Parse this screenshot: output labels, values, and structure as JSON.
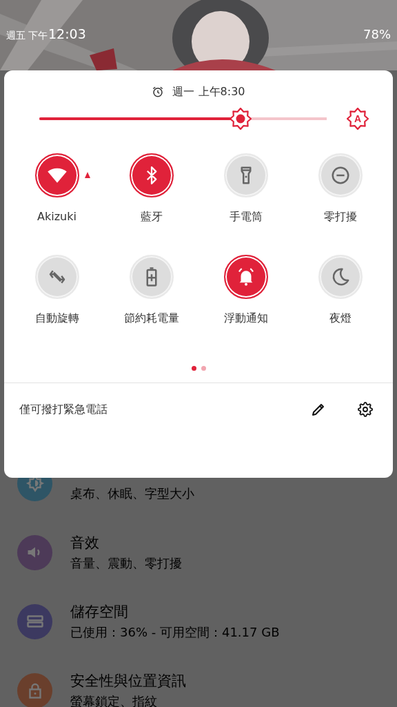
{
  "status_bar": {
    "day": "週五",
    "period": "下午",
    "time": "12:03",
    "battery": "78%"
  },
  "quick_settings": {
    "alarm": "週一 上午8:30",
    "brightness": {
      "level": 0.7,
      "auto_label": "A"
    },
    "tiles": [
      {
        "kind": "wifi",
        "label": "Akizuki",
        "on": true,
        "has_menu": true
      },
      {
        "kind": "bluetooth",
        "label": "藍牙",
        "on": true,
        "has_menu": false
      },
      {
        "kind": "flashlight",
        "label": "手電筒",
        "on": false,
        "has_menu": false
      },
      {
        "kind": "dnd",
        "label": "零打擾",
        "on": false,
        "has_menu": false
      },
      {
        "kind": "rotate",
        "label": "自動旋轉",
        "on": false,
        "has_menu": false
      },
      {
        "kind": "battery",
        "label": "節約耗電量",
        "on": false,
        "has_menu": false
      },
      {
        "kind": "bell",
        "label": "浮動通知",
        "on": true,
        "has_menu": false
      },
      {
        "kind": "moon",
        "label": "夜燈",
        "on": false,
        "has_menu": false
      }
    ],
    "pages": [
      {
        "selected": true
      },
      {
        "selected": false
      }
    ],
    "footer": {
      "text": "僅可撥打緊急電話"
    }
  },
  "settings_list": [
    {
      "kind": "display",
      "color": "#2e5566",
      "subtitle": "桌布、休眠、字型大小"
    },
    {
      "kind": "sound",
      "color": "#4d3a58",
      "title": "音效",
      "subtitle": "音量、震動、零打擾"
    },
    {
      "kind": "storage",
      "color": "#3c3960",
      "title": "儲存空間",
      "subtitle": "已使用：36% - 可用空間：41.17 GB"
    },
    {
      "kind": "security",
      "color": "#6a3f2c",
      "title": "安全性與位置資訊",
      "subtitle": "螢幕鎖定、指紋"
    }
  ]
}
